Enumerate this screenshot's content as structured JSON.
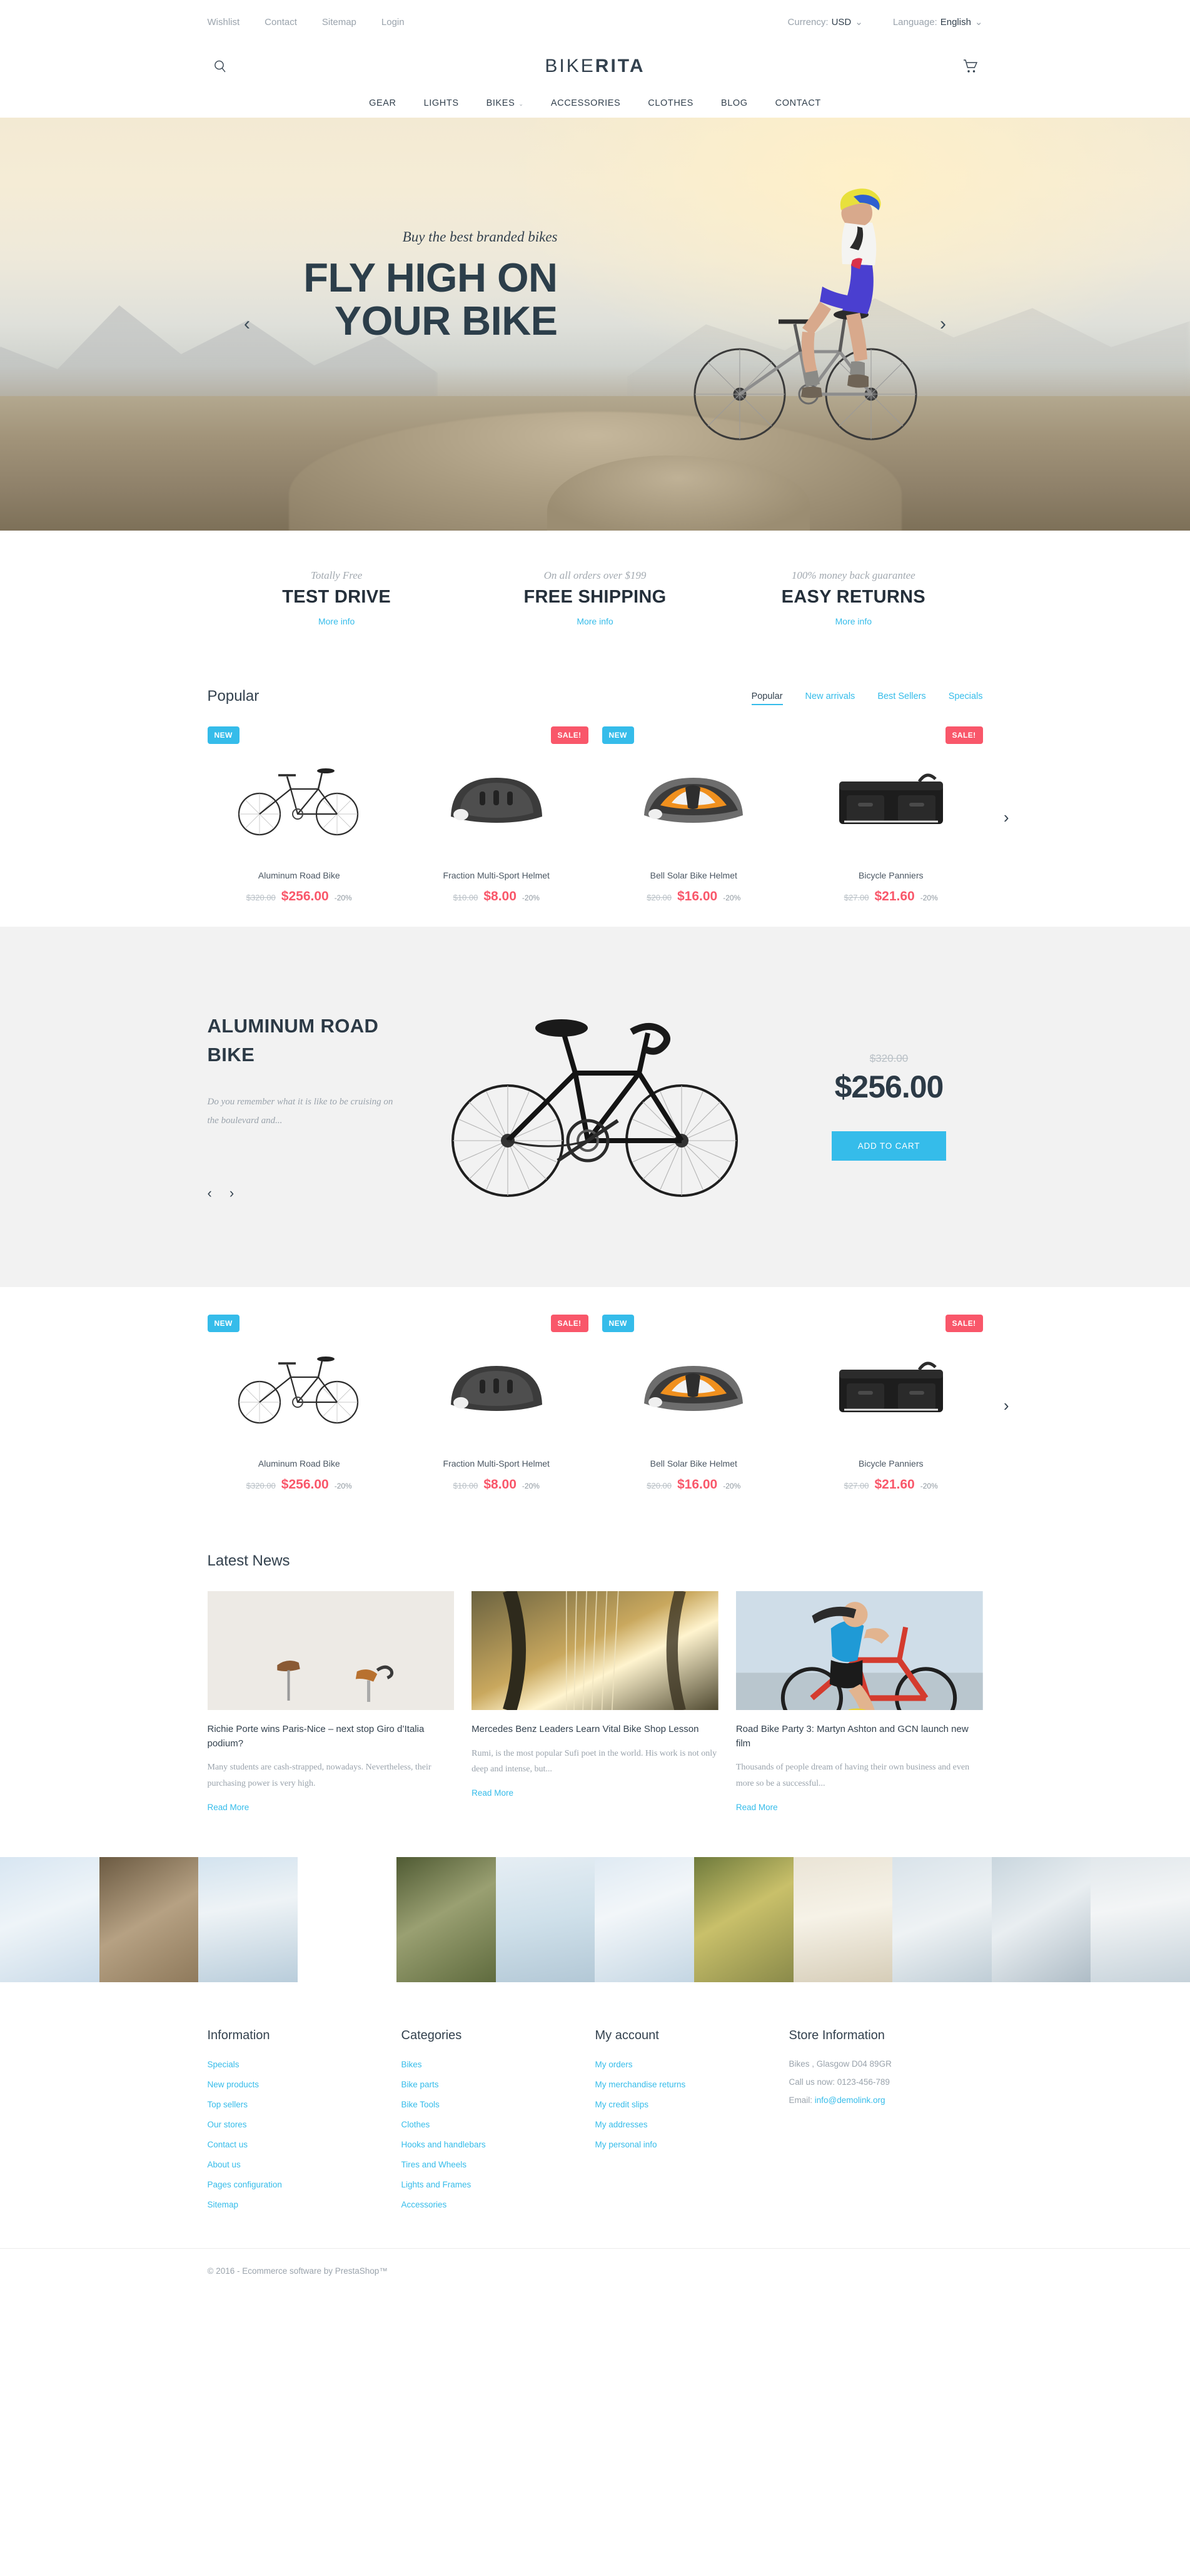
{
  "topbar": {
    "links": [
      {
        "label": "Wishlist"
      },
      {
        "label": "Contact"
      },
      {
        "label": "Sitemap"
      },
      {
        "label": "Login"
      }
    ],
    "currency_label": "Currency:",
    "currency_value": "USD",
    "language_label": "Language:",
    "language_value": "English",
    "caret": "⌄"
  },
  "header": {
    "logo_first": "BIKE",
    "logo_second": "RITA",
    "search_icon": "search-icon",
    "cart_icon": "cart-icon"
  },
  "nav": {
    "items": [
      {
        "label": "GEAR",
        "has_caret": false
      },
      {
        "label": "LIGHTS",
        "has_caret": false
      },
      {
        "label": "BIKES",
        "has_caret": true
      },
      {
        "label": "ACCESSORIES",
        "has_caret": false
      },
      {
        "label": "CLOTHES",
        "has_caret": false
      },
      {
        "label": "BLOG",
        "has_caret": false
      },
      {
        "label": "CONTACT",
        "has_caret": false
      }
    ],
    "caret": "⌄"
  },
  "hero": {
    "subtitle": "Buy the best branded bikes",
    "title_line1": "FLY HIGH ON",
    "title_line2": "YOUR BIKE",
    "prev": "‹",
    "next": "›"
  },
  "services": [
    {
      "sub": "Totally Free",
      "title": "TEST DRIVE",
      "link": "More info"
    },
    {
      "sub": "On all orders over $199",
      "title": "FREE SHIPPING",
      "link": "More info"
    },
    {
      "sub": "100% money back guarantee",
      "title": "EASY RETURNS",
      "link": "More info"
    }
  ],
  "popular": {
    "heading": "Popular",
    "tabs": [
      {
        "label": "Popular",
        "active": true
      },
      {
        "label": "New arrivals",
        "active": false
      },
      {
        "label": "Best Sellers",
        "active": false
      },
      {
        "label": "Specials",
        "active": false
      }
    ],
    "next_arrow": "›",
    "products": [
      {
        "name": "Aluminum Road Bike",
        "old_price": "$320.00",
        "price": "$256.00",
        "discount": "-20%",
        "badge_new": "NEW",
        "badge_sale": ""
      },
      {
        "name": "Fraction Multi-Sport Helmet",
        "old_price": "$10.00",
        "price": "$8.00",
        "discount": "-20%",
        "badge_new": "",
        "badge_sale": "SALE!"
      },
      {
        "name": "Bell Solar Bike Helmet",
        "old_price": "$20.00",
        "price": "$16.00",
        "discount": "-20%",
        "badge_new": "NEW",
        "badge_sale": ""
      },
      {
        "name": "Bicycle Panniers",
        "old_price": "$27.00",
        "price": "$21.60",
        "discount": "-20%",
        "badge_new": "",
        "badge_sale": "SALE!"
      }
    ]
  },
  "spotlight": {
    "name": "ALUMINUM ROAD BIKE",
    "description": "Do you remember what it is like to be cruising on the boulevard and...",
    "old_price": "$320.00",
    "price": "$256.00",
    "add_to_cart": "ADD TO CART",
    "prev": "‹",
    "next": "›"
  },
  "secondary_grid": {
    "next_arrow": "›",
    "products": [
      {
        "name": "Aluminum Road Bike",
        "old_price": "$320.00",
        "price": "$256.00",
        "discount": "-20%",
        "badge_new": "NEW",
        "badge_sale": ""
      },
      {
        "name": "Fraction Multi-Sport Helmet",
        "old_price": "$10.00",
        "price": "$8.00",
        "discount": "-20%",
        "badge_new": "",
        "badge_sale": "SALE!"
      },
      {
        "name": "Bell Solar Bike Helmet",
        "old_price": "$20.00",
        "price": "$16.00",
        "discount": "-20%",
        "badge_new": "NEW",
        "badge_sale": ""
      },
      {
        "name": "Bicycle Panniers",
        "old_price": "$27.00",
        "price": "$21.60",
        "discount": "-20%",
        "badge_new": "",
        "badge_sale": "SALE!"
      }
    ]
  },
  "news": {
    "heading": "Latest News",
    "articles": [
      {
        "title": "Richie Porte wins Paris-Nice – next stop Giro d’Italia podium?",
        "excerpt": "Many students are cash-strapped, nowadays. Nevertheless, their purchasing power is very high.",
        "more": "Read More"
      },
      {
        "title": "Mercedes Benz Leaders Learn Vital Bike Shop Lesson",
        "excerpt": "Rumi, is the most popular Sufi poet in the world. His work is not only deep and intense, but...",
        "more": "Read More"
      },
      {
        "title": "Road Bike Party 3: Martyn Ashton and GCN launch new film",
        "excerpt": "Thousands of people dream of having their own business and even more so be a successful...",
        "more": "Read More"
      }
    ]
  },
  "footer": {
    "information": {
      "heading": "Information",
      "links": [
        {
          "label": "Specials"
        },
        {
          "label": "New products"
        },
        {
          "label": "Top sellers"
        },
        {
          "label": "Our stores"
        },
        {
          "label": "Contact us"
        },
        {
          "label": "About us"
        },
        {
          "label": "Pages configuration"
        },
        {
          "label": "Sitemap"
        }
      ]
    },
    "categories": {
      "heading": "Categories",
      "links": [
        {
          "label": "Bikes"
        },
        {
          "label": "Bike parts"
        },
        {
          "label": "Bike Tools"
        },
        {
          "label": "Clothes"
        },
        {
          "label": "Hooks and handlebars"
        },
        {
          "label": "Tires and Wheels"
        },
        {
          "label": "Lights and Frames"
        },
        {
          "label": "Accessories"
        }
      ]
    },
    "my_account": {
      "heading": "My account",
      "links": [
        {
          "label": "My orders"
        },
        {
          "label": "My merchandise returns"
        },
        {
          "label": "My credit slips"
        },
        {
          "label": "My addresses"
        },
        {
          "label": "My personal info"
        }
      ]
    },
    "store_information": {
      "heading": "Store Information",
      "address": "Bikes , Glasgow D04 89GR",
      "phone": "Call us now: 0123-456-789",
      "email_label": "Email:",
      "email": "info@demolink.org"
    },
    "copyright": "© 2016 - Ecommerce software by PrestaShop™"
  },
  "colors": {
    "accent_blue": "#35bcea",
    "sale_red": "#f9576a",
    "dark_text": "#33414e",
    "muted_text": "#9aa3ac"
  }
}
